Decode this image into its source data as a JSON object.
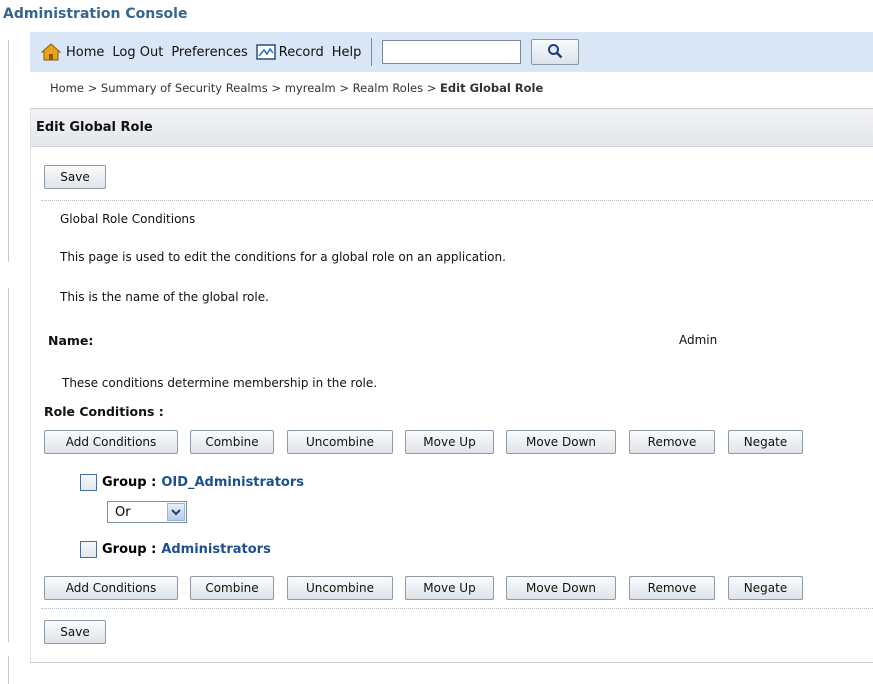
{
  "app": {
    "title": "Administration Console"
  },
  "toolbar": {
    "home": "Home",
    "logout": "Log Out",
    "preferences": "Preferences",
    "record": "Record",
    "help": "Help",
    "search_value": "",
    "icons": {
      "home": "home-icon",
      "record": "record-icon",
      "search": "magnifier-icon"
    }
  },
  "breadcrumb": {
    "items": [
      "Home >",
      "Summary of Security Realms >",
      "myrealm >",
      "Realm Roles >"
    ],
    "current": "Edit Global Role"
  },
  "panel": {
    "title": "Edit Global Role",
    "save_label": "Save",
    "section_title": "Global Role Conditions",
    "description": "This page is used to edit the conditions for a global role on an application.",
    "name_help": "This is the name of the global role.",
    "name_label": "Name:",
    "name_value": "Admin",
    "conditions_help": "These conditions determine membership in the role.",
    "conditions_label": "Role Conditions :",
    "actions": [
      "Add Conditions",
      "Combine",
      "Uncombine",
      "Move Up",
      "Move Down",
      "Remove",
      "Negate"
    ],
    "conditions": [
      {
        "prefix": "Group :",
        "name": "OID_Administrators",
        "checked": false
      },
      {
        "prefix": "Group :",
        "name": "Administrators",
        "checked": false
      }
    ],
    "operator": {
      "selected": "Or"
    }
  },
  "colors": {
    "title": "#36658f",
    "toolbar_bg": "#d9e6f5",
    "group_link": "#1f4f8f"
  }
}
